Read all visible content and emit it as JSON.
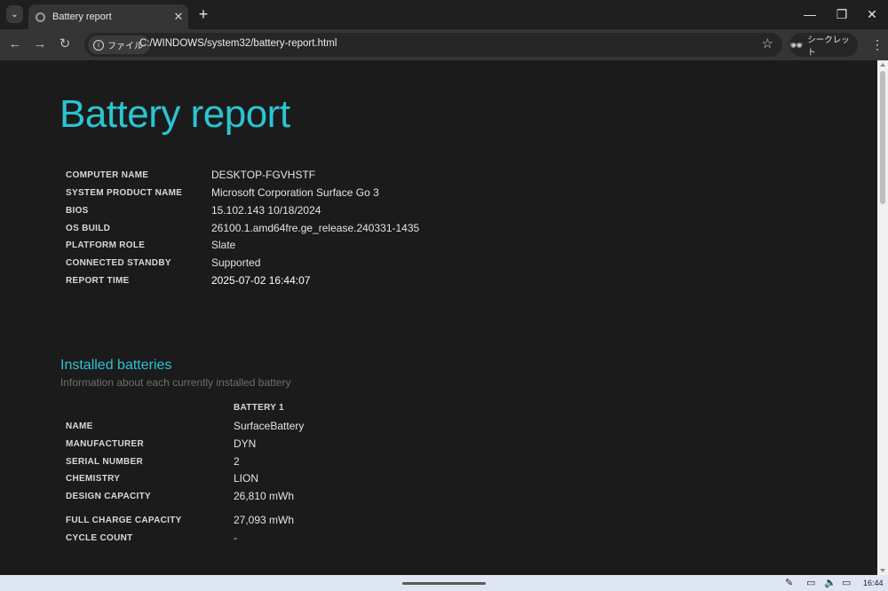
{
  "browser": {
    "tab_title": "Battery report",
    "tab_close": "✕",
    "new_tab": "+",
    "chip_label": "ファイル",
    "url": "C:/WINDOWS/system32/battery-report.html",
    "incognito_label": "シークレット"
  },
  "report": {
    "title": "Battery report",
    "system_info": [
      {
        "key": "COMPUTER NAME",
        "value": "DESKTOP-FGVHSTF"
      },
      {
        "key": "SYSTEM PRODUCT NAME",
        "value": "Microsoft Corporation Surface Go 3"
      },
      {
        "key": "BIOS",
        "value": "15.102.143 10/18/2024"
      },
      {
        "key": "OS BUILD",
        "value": "26100.1.amd64fre.ge_release.240331-1435"
      },
      {
        "key": "PLATFORM ROLE",
        "value": "Slate"
      },
      {
        "key": "CONNECTED STANDBY",
        "value": "Supported"
      },
      {
        "key": "REPORT TIME",
        "value": "2025-07-02  16:44:07"
      }
    ],
    "installed_batteries": {
      "title": "Installed batteries",
      "subtitle": "Information about each currently installed battery",
      "column": "BATTERY 1",
      "rows": [
        {
          "key": "NAME",
          "value": "SurfaceBattery"
        },
        {
          "key": "MANUFACTURER",
          "value": "DYN"
        },
        {
          "key": "SERIAL NUMBER",
          "value": "2"
        },
        {
          "key": "CHEMISTRY",
          "value": "LION"
        },
        {
          "key": "DESIGN CAPACITY",
          "value": "26,810 mWh"
        },
        {
          "key": "FULL CHARGE CAPACITY",
          "value": "27,093 mWh"
        },
        {
          "key": "CYCLE COUNT",
          "value": "-"
        }
      ]
    }
  },
  "taskbar": {
    "clock": "16:44"
  },
  "colors": {
    "accent": "#2bc4d2",
    "page_bg": "#1b1b1b"
  }
}
